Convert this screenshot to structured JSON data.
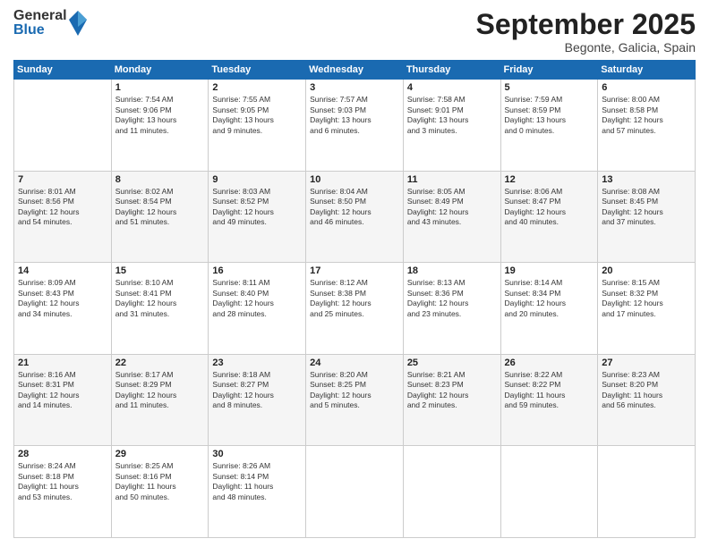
{
  "header": {
    "logo_general": "General",
    "logo_blue": "Blue",
    "month_title": "September 2025",
    "location": "Begonte, Galicia, Spain"
  },
  "weekdays": [
    "Sunday",
    "Monday",
    "Tuesday",
    "Wednesday",
    "Thursday",
    "Friday",
    "Saturday"
  ],
  "weeks": [
    [
      {
        "day": "",
        "info": ""
      },
      {
        "day": "1",
        "info": "Sunrise: 7:54 AM\nSunset: 9:06 PM\nDaylight: 13 hours\nand 11 minutes."
      },
      {
        "day": "2",
        "info": "Sunrise: 7:55 AM\nSunset: 9:05 PM\nDaylight: 13 hours\nand 9 minutes."
      },
      {
        "day": "3",
        "info": "Sunrise: 7:57 AM\nSunset: 9:03 PM\nDaylight: 13 hours\nand 6 minutes."
      },
      {
        "day": "4",
        "info": "Sunrise: 7:58 AM\nSunset: 9:01 PM\nDaylight: 13 hours\nand 3 minutes."
      },
      {
        "day": "5",
        "info": "Sunrise: 7:59 AM\nSunset: 8:59 PM\nDaylight: 13 hours\nand 0 minutes."
      },
      {
        "day": "6",
        "info": "Sunrise: 8:00 AM\nSunset: 8:58 PM\nDaylight: 12 hours\nand 57 minutes."
      }
    ],
    [
      {
        "day": "7",
        "info": "Sunrise: 8:01 AM\nSunset: 8:56 PM\nDaylight: 12 hours\nand 54 minutes."
      },
      {
        "day": "8",
        "info": "Sunrise: 8:02 AM\nSunset: 8:54 PM\nDaylight: 12 hours\nand 51 minutes."
      },
      {
        "day": "9",
        "info": "Sunrise: 8:03 AM\nSunset: 8:52 PM\nDaylight: 12 hours\nand 49 minutes."
      },
      {
        "day": "10",
        "info": "Sunrise: 8:04 AM\nSunset: 8:50 PM\nDaylight: 12 hours\nand 46 minutes."
      },
      {
        "day": "11",
        "info": "Sunrise: 8:05 AM\nSunset: 8:49 PM\nDaylight: 12 hours\nand 43 minutes."
      },
      {
        "day": "12",
        "info": "Sunrise: 8:06 AM\nSunset: 8:47 PM\nDaylight: 12 hours\nand 40 minutes."
      },
      {
        "day": "13",
        "info": "Sunrise: 8:08 AM\nSunset: 8:45 PM\nDaylight: 12 hours\nand 37 minutes."
      }
    ],
    [
      {
        "day": "14",
        "info": "Sunrise: 8:09 AM\nSunset: 8:43 PM\nDaylight: 12 hours\nand 34 minutes."
      },
      {
        "day": "15",
        "info": "Sunrise: 8:10 AM\nSunset: 8:41 PM\nDaylight: 12 hours\nand 31 minutes."
      },
      {
        "day": "16",
        "info": "Sunrise: 8:11 AM\nSunset: 8:40 PM\nDaylight: 12 hours\nand 28 minutes."
      },
      {
        "day": "17",
        "info": "Sunrise: 8:12 AM\nSunset: 8:38 PM\nDaylight: 12 hours\nand 25 minutes."
      },
      {
        "day": "18",
        "info": "Sunrise: 8:13 AM\nSunset: 8:36 PM\nDaylight: 12 hours\nand 23 minutes."
      },
      {
        "day": "19",
        "info": "Sunrise: 8:14 AM\nSunset: 8:34 PM\nDaylight: 12 hours\nand 20 minutes."
      },
      {
        "day": "20",
        "info": "Sunrise: 8:15 AM\nSunset: 8:32 PM\nDaylight: 12 hours\nand 17 minutes."
      }
    ],
    [
      {
        "day": "21",
        "info": "Sunrise: 8:16 AM\nSunset: 8:31 PM\nDaylight: 12 hours\nand 14 minutes."
      },
      {
        "day": "22",
        "info": "Sunrise: 8:17 AM\nSunset: 8:29 PM\nDaylight: 12 hours\nand 11 minutes."
      },
      {
        "day": "23",
        "info": "Sunrise: 8:18 AM\nSunset: 8:27 PM\nDaylight: 12 hours\nand 8 minutes."
      },
      {
        "day": "24",
        "info": "Sunrise: 8:20 AM\nSunset: 8:25 PM\nDaylight: 12 hours\nand 5 minutes."
      },
      {
        "day": "25",
        "info": "Sunrise: 8:21 AM\nSunset: 8:23 PM\nDaylight: 12 hours\nand 2 minutes."
      },
      {
        "day": "26",
        "info": "Sunrise: 8:22 AM\nSunset: 8:22 PM\nDaylight: 11 hours\nand 59 minutes."
      },
      {
        "day": "27",
        "info": "Sunrise: 8:23 AM\nSunset: 8:20 PM\nDaylight: 11 hours\nand 56 minutes."
      }
    ],
    [
      {
        "day": "28",
        "info": "Sunrise: 8:24 AM\nSunset: 8:18 PM\nDaylight: 11 hours\nand 53 minutes."
      },
      {
        "day": "29",
        "info": "Sunrise: 8:25 AM\nSunset: 8:16 PM\nDaylight: 11 hours\nand 50 minutes."
      },
      {
        "day": "30",
        "info": "Sunrise: 8:26 AM\nSunset: 8:14 PM\nDaylight: 11 hours\nand 48 minutes."
      },
      {
        "day": "",
        "info": ""
      },
      {
        "day": "",
        "info": ""
      },
      {
        "day": "",
        "info": ""
      },
      {
        "day": "",
        "info": ""
      }
    ]
  ]
}
